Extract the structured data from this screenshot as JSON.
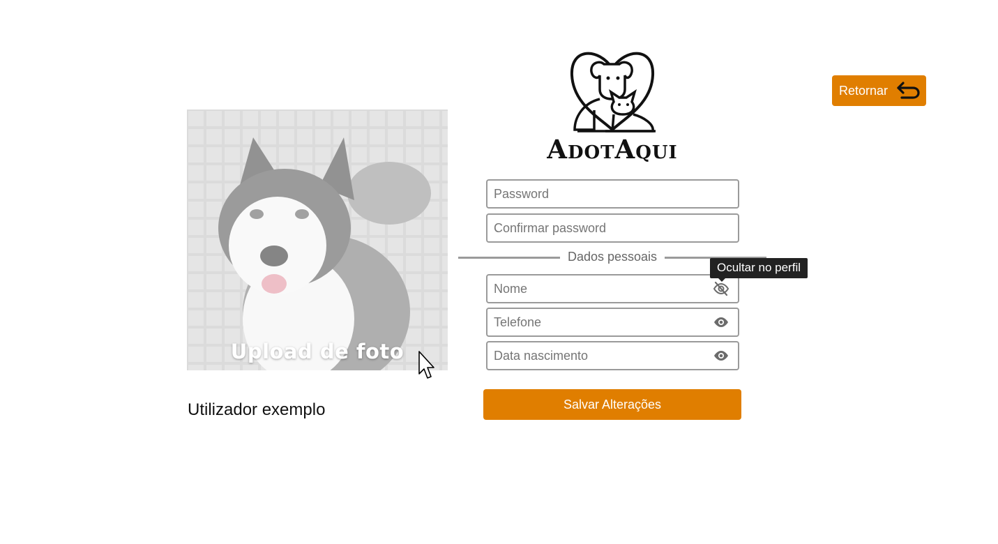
{
  "profile": {
    "upload_label": "Upload de foto",
    "username": "Utilizador exemplo"
  },
  "brand": {
    "logo_text": "AdotAqui"
  },
  "header": {
    "return_label": "Retornar"
  },
  "form": {
    "password_placeholder": "Password",
    "confirm_password_placeholder": "Confirmar password",
    "section_label": "Dados pessoais",
    "name_placeholder": "Nome",
    "phone_placeholder": "Telefone",
    "birthdate_placeholder": "Data nascimento",
    "tooltip": "Ocultar no perfil",
    "save_label": "Salvar Alterações"
  },
  "colors": {
    "accent": "#e07e00",
    "tooltip_bg": "#222222",
    "field_border": "#9a9a9a"
  },
  "icons": {
    "name_visibility": "eye-off-icon",
    "phone_visibility": "eye-icon",
    "birthdate_visibility": "eye-icon",
    "return": "return-arrow-icon"
  }
}
